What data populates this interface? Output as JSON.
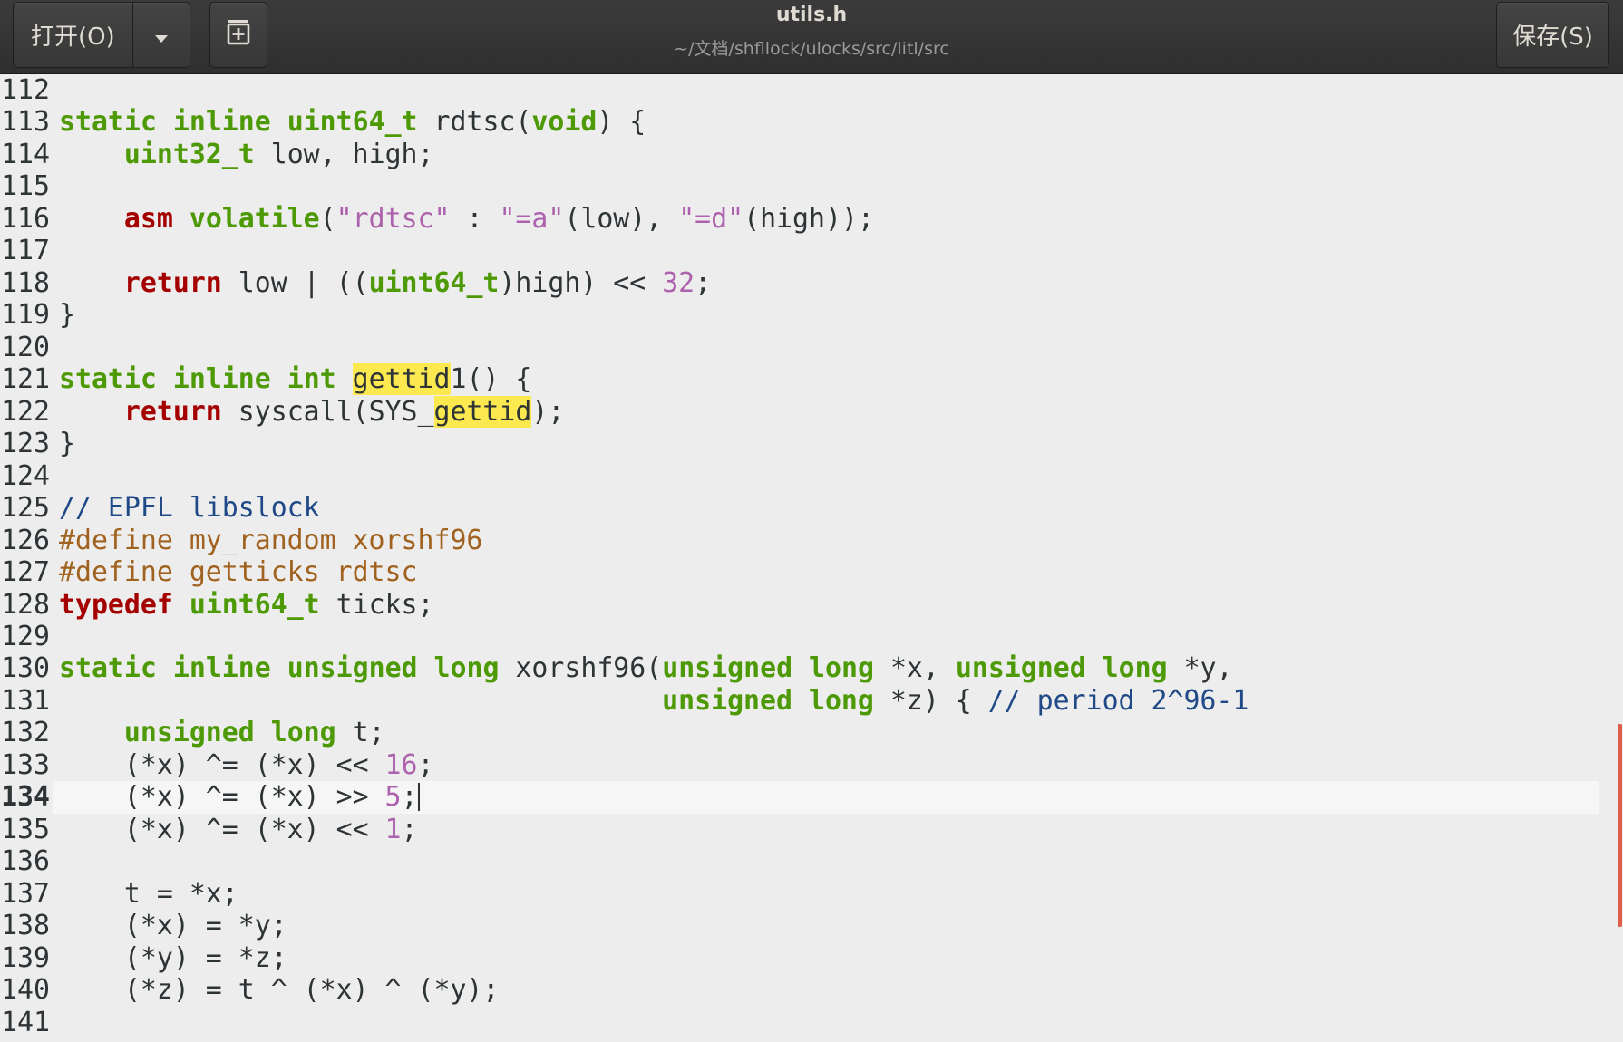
{
  "window": {
    "title": "utils.h",
    "subtitle": "~/文档/shfllock/ulocks/src/litl/src"
  },
  "toolbar": {
    "open_label": "打开(O)",
    "open_menu_icon": "chevron-down-icon",
    "new_document_icon": "new-document-icon",
    "save_label": "保存(S)"
  },
  "colors": {
    "header_text": "#dfdbd2",
    "header_subtext": "#9a9a9a",
    "editor_bg": "#ededed",
    "current_line_bg": "#f6f6f6",
    "text": "#2e3436",
    "line_number": "#2e3436",
    "type_keyword": "#4e9a06",
    "statement_keyword": "#a40000",
    "string": "#ad62ad",
    "number": "#ad62ad",
    "comment": "#204a87",
    "preprocessor": "#a0621e",
    "search_highlight": "#fce94f",
    "cursor": "#2e3436",
    "scrollbar_thumb": "#e05d4b"
  },
  "editor": {
    "current_line": 134,
    "search_term": "gettid",
    "scrollbar": {
      "position": 0.85,
      "thumb_fraction": 0.21
    },
    "lines": [
      {
        "n": 112,
        "tokens": []
      },
      {
        "n": 113,
        "tokens": [
          {
            "t": "kw",
            "s": "static"
          },
          {
            "t": "p",
            "s": " "
          },
          {
            "t": "kw",
            "s": "inline"
          },
          {
            "t": "p",
            "s": " "
          },
          {
            "t": "kw",
            "s": "uint64_t"
          },
          {
            "t": "p",
            "s": " rdtsc("
          },
          {
            "t": "kw",
            "s": "void"
          },
          {
            "t": "p",
            "s": ") {"
          }
        ]
      },
      {
        "n": 114,
        "tokens": [
          {
            "t": "p",
            "s": "    "
          },
          {
            "t": "kw",
            "s": "uint32_t"
          },
          {
            "t": "p",
            "s": " low, high;"
          }
        ]
      },
      {
        "n": 115,
        "tokens": []
      },
      {
        "n": 116,
        "tokens": [
          {
            "t": "p",
            "s": "    "
          },
          {
            "t": "ctl",
            "s": "asm"
          },
          {
            "t": "p",
            "s": " "
          },
          {
            "t": "kw",
            "s": "volatile"
          },
          {
            "t": "p",
            "s": "("
          },
          {
            "t": "str",
            "s": "\"rdtsc\""
          },
          {
            "t": "p",
            "s": " : "
          },
          {
            "t": "str",
            "s": "\"=a\""
          },
          {
            "t": "p",
            "s": "(low), "
          },
          {
            "t": "str",
            "s": "\"=d\""
          },
          {
            "t": "p",
            "s": "(high));"
          }
        ]
      },
      {
        "n": 117,
        "tokens": []
      },
      {
        "n": 118,
        "tokens": [
          {
            "t": "p",
            "s": "    "
          },
          {
            "t": "ctl",
            "s": "return"
          },
          {
            "t": "p",
            "s": " low | (("
          },
          {
            "t": "kw",
            "s": "uint64_t"
          },
          {
            "t": "p",
            "s": ")high) << "
          },
          {
            "t": "num",
            "s": "32"
          },
          {
            "t": "p",
            "s": ";"
          }
        ]
      },
      {
        "n": 119,
        "tokens": [
          {
            "t": "p",
            "s": "}"
          }
        ]
      },
      {
        "n": 120,
        "tokens": []
      },
      {
        "n": 121,
        "tokens": [
          {
            "t": "kw",
            "s": "static"
          },
          {
            "t": "p",
            "s": " "
          },
          {
            "t": "kw",
            "s": "inline"
          },
          {
            "t": "p",
            "s": " "
          },
          {
            "t": "kw",
            "s": "int"
          },
          {
            "t": "p",
            "s": " "
          },
          {
            "t": "hl",
            "s": "gettid"
          },
          {
            "t": "p",
            "s": "1() {"
          }
        ]
      },
      {
        "n": 122,
        "tokens": [
          {
            "t": "p",
            "s": "    "
          },
          {
            "t": "ctl",
            "s": "return"
          },
          {
            "t": "p",
            "s": " syscall(SYS_"
          },
          {
            "t": "hl",
            "s": "gettid"
          },
          {
            "t": "p",
            "s": ");"
          }
        ]
      },
      {
        "n": 123,
        "tokens": [
          {
            "t": "p",
            "s": "}"
          }
        ]
      },
      {
        "n": 124,
        "tokens": []
      },
      {
        "n": 125,
        "tokens": [
          {
            "t": "cmt",
            "s": "// EPFL libslock"
          }
        ]
      },
      {
        "n": 126,
        "tokens": [
          {
            "t": "pre",
            "s": "#define my_random xorshf96"
          }
        ]
      },
      {
        "n": 127,
        "tokens": [
          {
            "t": "pre",
            "s": "#define getticks rdtsc"
          }
        ]
      },
      {
        "n": 128,
        "tokens": [
          {
            "t": "ctl",
            "s": "typedef"
          },
          {
            "t": "p",
            "s": " "
          },
          {
            "t": "kw",
            "s": "uint64_t"
          },
          {
            "t": "p",
            "s": " ticks;"
          }
        ]
      },
      {
        "n": 129,
        "tokens": []
      },
      {
        "n": 130,
        "tokens": [
          {
            "t": "kw",
            "s": "static"
          },
          {
            "t": "p",
            "s": " "
          },
          {
            "t": "kw",
            "s": "inline"
          },
          {
            "t": "p",
            "s": " "
          },
          {
            "t": "kw",
            "s": "unsigned"
          },
          {
            "t": "p",
            "s": " "
          },
          {
            "t": "kw",
            "s": "long"
          },
          {
            "t": "p",
            "s": " xorshf96("
          },
          {
            "t": "kw",
            "s": "unsigned"
          },
          {
            "t": "p",
            "s": " "
          },
          {
            "t": "kw",
            "s": "long"
          },
          {
            "t": "p",
            "s": " *x, "
          },
          {
            "t": "kw",
            "s": "unsigned"
          },
          {
            "t": "p",
            "s": " "
          },
          {
            "t": "kw",
            "s": "long"
          },
          {
            "t": "p",
            "s": " *y,"
          }
        ]
      },
      {
        "n": 131,
        "tokens": [
          {
            "t": "p",
            "s": "                                     "
          },
          {
            "t": "kw",
            "s": "unsigned"
          },
          {
            "t": "p",
            "s": " "
          },
          {
            "t": "kw",
            "s": "long"
          },
          {
            "t": "p",
            "s": " *z) { "
          },
          {
            "t": "cmt",
            "s": "// period 2^96-1"
          }
        ]
      },
      {
        "n": 132,
        "tokens": [
          {
            "t": "p",
            "s": "    "
          },
          {
            "t": "kw",
            "s": "unsigned"
          },
          {
            "t": "p",
            "s": " "
          },
          {
            "t": "kw",
            "s": "long"
          },
          {
            "t": "p",
            "s": " t;"
          }
        ]
      },
      {
        "n": 133,
        "tokens": [
          {
            "t": "p",
            "s": "    (*x) ^= (*x) << "
          },
          {
            "t": "num",
            "s": "16"
          },
          {
            "t": "p",
            "s": ";"
          }
        ]
      },
      {
        "n": 134,
        "tokens": [
          {
            "t": "p",
            "s": "    (*x) ^= (*x) >> "
          },
          {
            "t": "num",
            "s": "5"
          },
          {
            "t": "p",
            "s": ";"
          }
        ]
      },
      {
        "n": 135,
        "tokens": [
          {
            "t": "p",
            "s": "    (*x) ^= (*x) << "
          },
          {
            "t": "num",
            "s": "1"
          },
          {
            "t": "p",
            "s": ";"
          }
        ]
      },
      {
        "n": 136,
        "tokens": []
      },
      {
        "n": 137,
        "tokens": [
          {
            "t": "p",
            "s": "    t = *x;"
          }
        ]
      },
      {
        "n": 138,
        "tokens": [
          {
            "t": "p",
            "s": "    (*x) = *y;"
          }
        ]
      },
      {
        "n": 139,
        "tokens": [
          {
            "t": "p",
            "s": "    (*y) = *z;"
          }
        ]
      },
      {
        "n": 140,
        "tokens": [
          {
            "t": "p",
            "s": "    (*z) = t ^ (*x) ^ (*y);"
          }
        ]
      },
      {
        "n": 141,
        "tokens": []
      }
    ]
  }
}
